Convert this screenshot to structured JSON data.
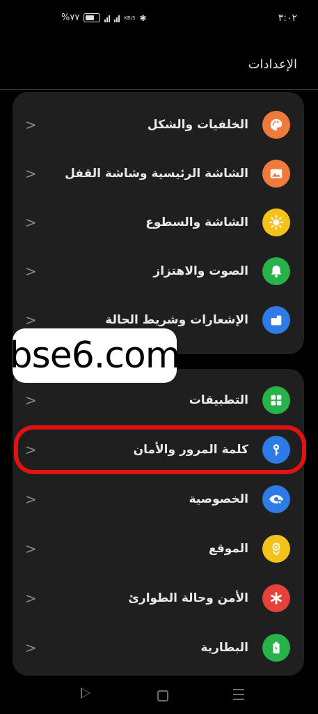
{
  "status": {
    "time": "٣:٠٢",
    "battery": "%٧٧",
    "net_speed": "KB/S"
  },
  "header": {
    "title": "الإعدادات"
  },
  "group1": [
    {
      "label": "الخلفيات والشكل",
      "icon": "palette-icon",
      "color": "#f07a3c"
    },
    {
      "label": "الشاشة الرئيسية وشاشة القفل",
      "icon": "image-icon",
      "color": "#f07a3c"
    },
    {
      "label": "الشاشة والسطوع",
      "icon": "sun-icon",
      "color": "#f3c21b"
    },
    {
      "label": "الصوت والاهتزاز",
      "icon": "bell-icon",
      "color": "#27b24a"
    },
    {
      "label": "الإشعارات وشريط الحالة",
      "icon": "notification-icon",
      "color": "#2f7be6"
    }
  ],
  "group2": [
    {
      "label": "التطبيقات",
      "icon": "apps-grid-icon",
      "color": "#27b24a"
    },
    {
      "label": "كلمة المرور والأمان",
      "icon": "key-icon",
      "color": "#2f7be6"
    },
    {
      "label": "الخصوصية",
      "icon": "privacy-eye-icon",
      "color": "#2f7be6"
    },
    {
      "label": "الموقع",
      "icon": "location-icon",
      "color": "#f3c21b"
    },
    {
      "label": "الأمن وحالة الطوارئ",
      "icon": "emergency-icon",
      "color": "#e5423b"
    },
    {
      "label": "البطارية",
      "icon": "battery-icon",
      "color": "#27b24a"
    }
  ],
  "watermark": "bse6.com"
}
